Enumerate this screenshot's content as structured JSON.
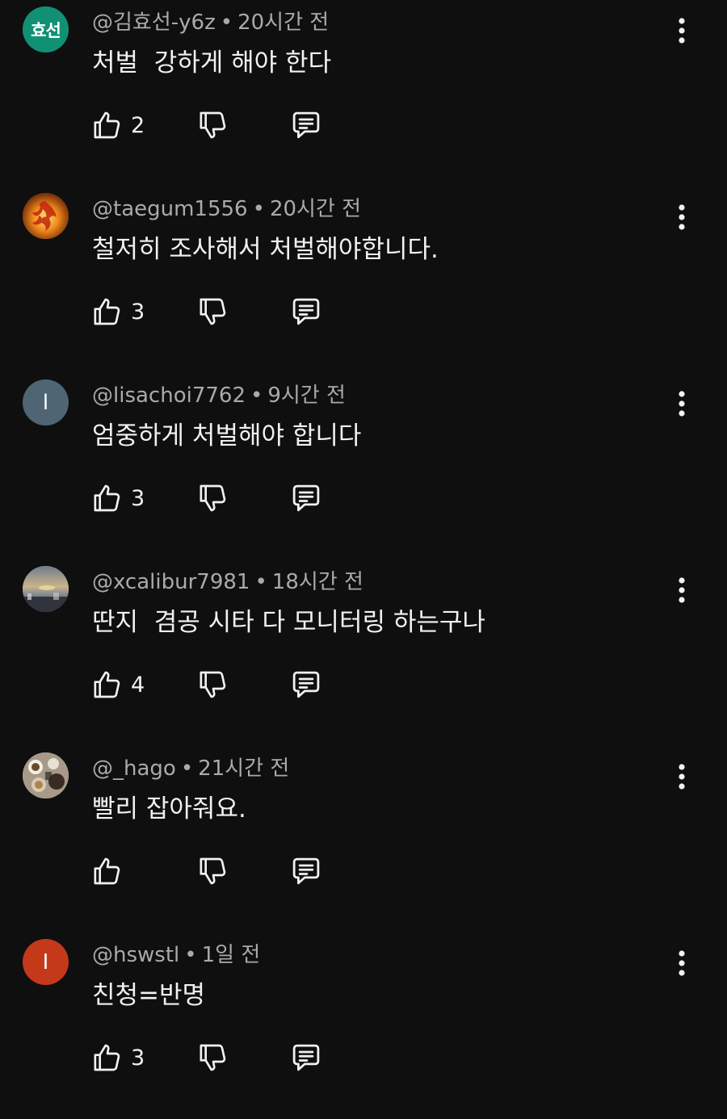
{
  "comments": [
    {
      "author": "@김효선-y6z",
      "time": "20시간 전",
      "text": "처벌  강하게 해야 한다",
      "likes": "2",
      "avatar": {
        "type": "initials",
        "label": "효선",
        "color": "#119174"
      }
    },
    {
      "author": "@taegum1556",
      "time": "20시간 전",
      "text": "철저히 조사해서 처벌해야합니다.",
      "likes": "3",
      "avatar": {
        "type": "image",
        "label": "",
        "color": "#b8480f"
      }
    },
    {
      "author": "@lisachoi7762",
      "time": "9시간 전",
      "text": "엄중하게 처벌해야 합니다",
      "likes": "3",
      "avatar": {
        "type": "initials",
        "label": "l",
        "color": "#4f6573"
      }
    },
    {
      "author": "@xcalibur7981",
      "time": "18시간 전",
      "text": "딴지  겸공 시타 다 모니터링 하는구나",
      "likes": "4",
      "avatar": {
        "type": "image",
        "label": "",
        "color": "#7a8593"
      }
    },
    {
      "author": "@_hago",
      "time": "21시간 전",
      "text": "빨리 잡아줘요.",
      "likes": "",
      "avatar": {
        "type": "image",
        "label": "",
        "color": "#8a7f72"
      }
    },
    {
      "author": "@hswstl",
      "time": "1일 전",
      "text": "친청=반명",
      "likes": "3",
      "avatar": {
        "type": "initials",
        "label": "I",
        "color": "#c4391a"
      }
    }
  ],
  "meta_separator": "•",
  "icons": {
    "like": "thumbs-up-icon",
    "dislike": "thumbs-down-icon",
    "reply": "comment-reply-icon",
    "more": "more-vertical-icon"
  },
  "colors": {
    "background": "#0f0f0f",
    "text_primary": "#f1f1f1",
    "text_secondary": "#aaaaaa"
  }
}
